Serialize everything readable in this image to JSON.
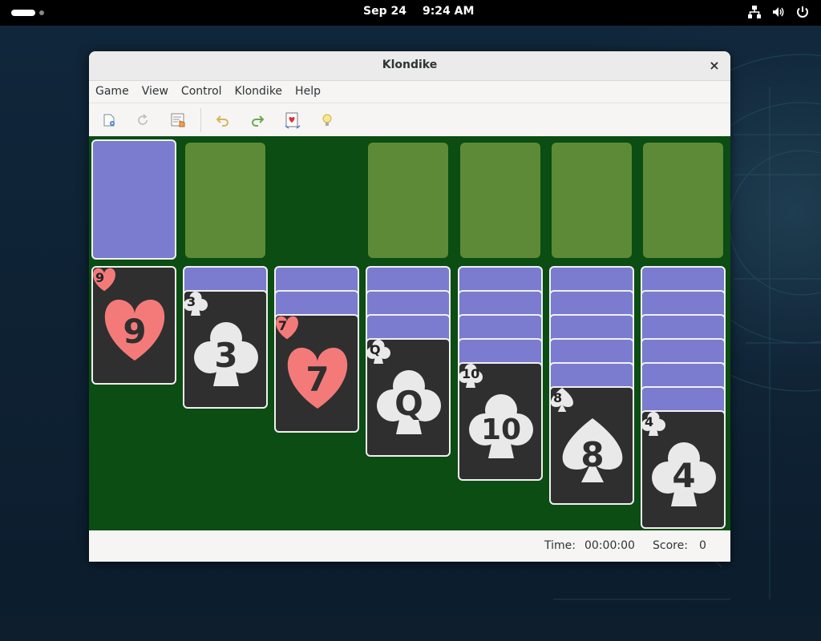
{
  "topbar": {
    "date": "Sep 24",
    "time": "9:24 AM"
  },
  "window": {
    "title": "Klondike",
    "close": "×"
  },
  "menu": [
    "Game",
    "View",
    "Control",
    "Klondike",
    "Help"
  ],
  "toolbar": {
    "icons": [
      "new-game-icon",
      "restart-icon",
      "select-game-icon",
      "undo-icon",
      "redo-icon",
      "deal-icon",
      "hint-icon"
    ]
  },
  "tableau": [
    {
      "rank": "9",
      "suit": "heart",
      "hidden": 0
    },
    {
      "rank": "3",
      "suit": "club",
      "hidden": 1
    },
    {
      "rank": "7",
      "suit": "heart",
      "hidden": 2
    },
    {
      "rank": "Q",
      "suit": "club",
      "hidden": 3
    },
    {
      "rank": "10",
      "suit": "club",
      "hidden": 4
    },
    {
      "rank": "8",
      "suit": "spade",
      "hidden": 5
    },
    {
      "rank": "4",
      "suit": "club",
      "hidden": 6
    }
  ],
  "colors": {
    "felt": "#0b4d12",
    "slot": "#5d8a37",
    "card_back": "#7b7bcf",
    "card_face": "#2f2f2f",
    "red": "#f47a7a",
    "black_suit": "#e9e9e9"
  },
  "status": {
    "time_label": "Time:",
    "time_value": "00:00:00",
    "score_label": "Score:",
    "score_value": "0"
  }
}
